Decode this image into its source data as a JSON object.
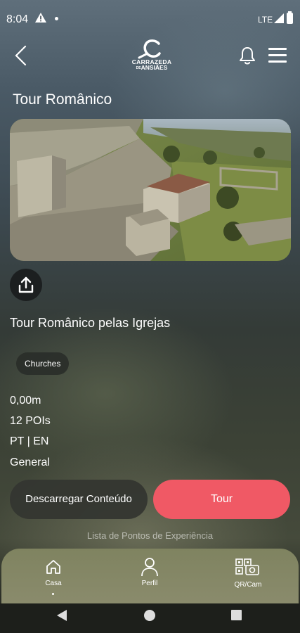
{
  "status_bar": {
    "time": "8:04",
    "network": "LTE"
  },
  "header": {
    "logo_name": "CARRAZEDA",
    "logo_sub": "ANSIÃES",
    "logo_connector": "DE"
  },
  "page_title": "Tour Românico",
  "tour": {
    "name": "Tour Românico pelas Igrejas",
    "category": "Churches",
    "distance": "0,00m",
    "pois": "12 POIs",
    "languages": "PT | EN",
    "type": "General"
  },
  "buttons": {
    "download": "Descarregar Conteúdo",
    "tour": "Tour"
  },
  "list_label": "Lista de Pontos de Experiência",
  "bottom_nav": [
    {
      "label": "Casa",
      "icon": "home-icon",
      "active": true
    },
    {
      "label": "Perfil",
      "icon": "profile-icon",
      "active": false
    },
    {
      "label": "QR/Cam",
      "icon": "qr-camera-icon",
      "active": false
    }
  ],
  "colors": {
    "accent": "#f05965",
    "chip_bg": "#2c2f2b"
  }
}
